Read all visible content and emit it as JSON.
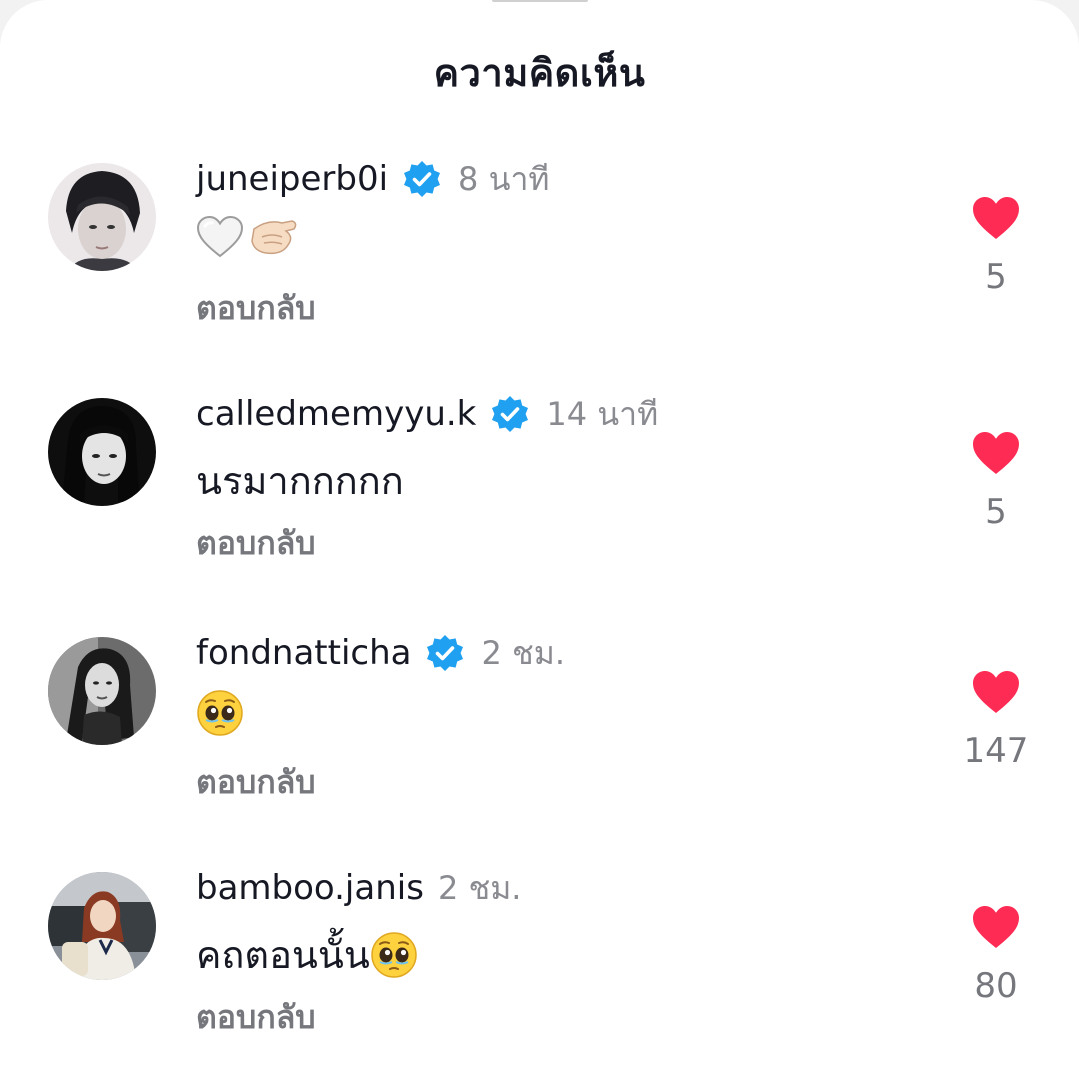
{
  "sheet": {
    "title": "ความคิดเห็น"
  },
  "reply_label": "ตอบกลับ",
  "colors": {
    "verified": "#20a0f0",
    "heart": "#fe2c55",
    "text_primary": "#161823",
    "text_secondary": "#8a8b91"
  },
  "comments": [
    {
      "username": "juneiperb0i",
      "verified": true,
      "time": "8 นาที",
      "text": "",
      "emojis": [
        "white-heart",
        "pinching-hand"
      ],
      "likes": "5",
      "reply": "ตอบกลับ"
    },
    {
      "username": "calledmemyyu.k",
      "verified": true,
      "time": "14 นาที",
      "text": "นรมากกกกก",
      "emojis": [],
      "likes": "5",
      "reply": "ตอบกลับ"
    },
    {
      "username": "fondnatticha",
      "verified": true,
      "time": "2 ชม.",
      "text": "",
      "emojis": [
        "pleading-face"
      ],
      "likes": "147",
      "reply": "ตอบกลับ"
    },
    {
      "username": "bamboo.janis",
      "verified": false,
      "time": "2 ชม.",
      "text": "คถตอนนั้น",
      "emojis": [
        "pleading-face"
      ],
      "likes": "80",
      "reply": "ตอบกลับ"
    }
  ]
}
